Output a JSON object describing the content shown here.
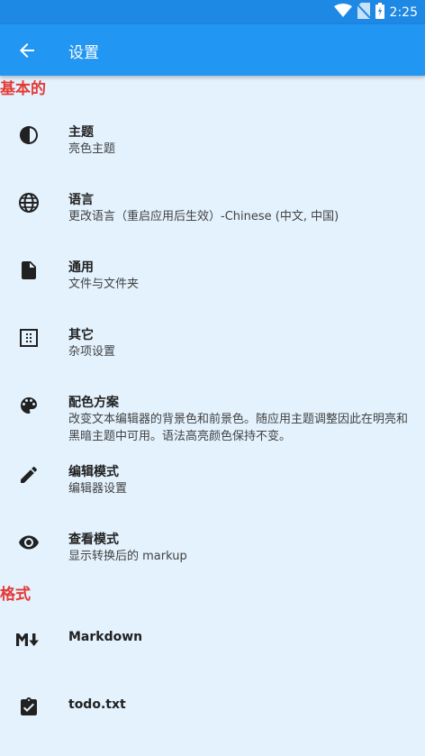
{
  "status_bar": {
    "time": "2:25"
  },
  "app_bar": {
    "title": "设置",
    "back_icon": "arrow-back-icon"
  },
  "sections": {
    "basic": {
      "header": "基本的",
      "items": [
        {
          "title": "主题",
          "summary": "亮色主题",
          "icon": "contrast-icon"
        },
        {
          "title": "语言",
          "summary": "更改语言（重启应用后生效）-Chinese (中文, 中国)",
          "icon": "globe-icon"
        },
        {
          "title": "通用",
          "summary": "文件与文件夹",
          "icon": "file-icon"
        },
        {
          "title": "其它",
          "summary": "杂项设置",
          "icon": "dots-grid-icon"
        },
        {
          "title": "配色方案",
          "summary": "改变文本编辑器的背景色和前景色。随应用主题调整因此在明亮和黑暗主题中可用。语法高亮颜色保持不变。",
          "icon": "palette-icon"
        },
        {
          "title": "编辑模式",
          "summary": "编辑器设置",
          "icon": "pencil-icon"
        },
        {
          "title": "查看模式",
          "summary": "显示转换后的 markup",
          "icon": "eye-icon"
        }
      ]
    },
    "format": {
      "header": "格式",
      "items": [
        {
          "title": "Markdown",
          "icon": "markdown-icon"
        },
        {
          "title": "todo.txt",
          "icon": "clipboard-check-icon"
        }
      ]
    }
  },
  "colors": {
    "status_bar": "#1e88e5",
    "app_bar": "#2196f3",
    "background": "#e3f2fd",
    "section_header": "#e53935"
  }
}
